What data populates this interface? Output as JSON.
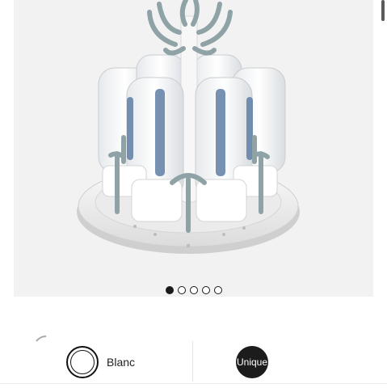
{
  "gallery": {
    "image_icon": "bottle-drying-rack-photo",
    "slide_count": 5,
    "active_slide": 1
  },
  "variants": {
    "color_label": "Blanc",
    "size_label": "Unique"
  },
  "colors": {
    "accent": "#1c1c1c",
    "background": "#f2f2f2",
    "rack_grey": "#8fa3a6"
  }
}
